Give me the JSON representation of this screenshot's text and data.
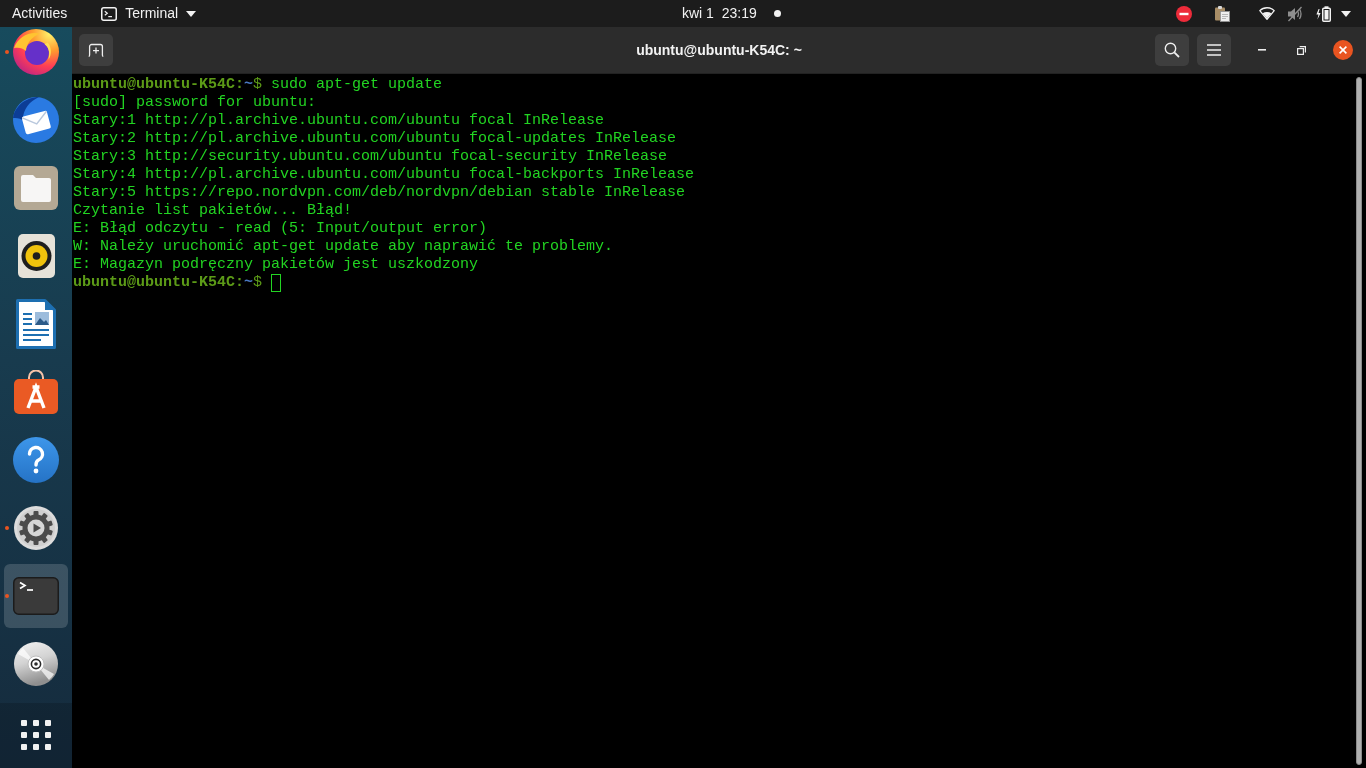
{
  "top_bar": {
    "activities": "Activities",
    "app_menu": "Terminal",
    "clock": "kwi 1  23:19"
  },
  "dock": {
    "items": [
      {
        "kind": "browser",
        "running": true,
        "selected": false
      },
      {
        "kind": "mail",
        "running": false,
        "selected": false
      },
      {
        "kind": "files",
        "running": false,
        "selected": false
      },
      {
        "kind": "music",
        "running": false,
        "selected": false
      },
      {
        "kind": "writer",
        "running": false,
        "selected": false
      },
      {
        "kind": "store",
        "running": false,
        "selected": false
      },
      {
        "kind": "help",
        "running": false,
        "selected": false
      },
      {
        "kind": "settings",
        "running": true,
        "selected": false
      },
      {
        "kind": "terminal",
        "running": true,
        "selected": true
      },
      {
        "kind": "disc",
        "running": false,
        "selected": false
      }
    ]
  },
  "window": {
    "title": "ubuntu@ubuntu-K54C: ~",
    "lines": [
      {
        "kind": "prompt",
        "user_host": "ubuntu@ubuntu-K54C:",
        "path": "~",
        "symbol": "$",
        "command": "sudo apt-get update",
        "cursor": false
      },
      {
        "kind": "output",
        "text": "[sudo] password for ubuntu:"
      },
      {
        "kind": "output",
        "text": "Stary:1 http://pl.archive.ubuntu.com/ubuntu focal InRelease"
      },
      {
        "kind": "output",
        "text": "Stary:2 http://pl.archive.ubuntu.com/ubuntu focal-updates InRelease"
      },
      {
        "kind": "output",
        "text": "Stary:3 http://security.ubuntu.com/ubuntu focal-security InRelease"
      },
      {
        "kind": "output",
        "text": "Stary:4 http://pl.archive.ubuntu.com/ubuntu focal-backports InRelease"
      },
      {
        "kind": "output",
        "text": "Stary:5 https://repo.nordvpn.com/deb/nordvpn/debian stable InRelease"
      },
      {
        "kind": "output",
        "text": "Czytanie list pakietów... Błąd!"
      },
      {
        "kind": "output",
        "text": "E: Błąd odczytu - read (5: Input/output error)"
      },
      {
        "kind": "output",
        "text": "W: Należy uruchomić apt-get update aby naprawić te problemy."
      },
      {
        "kind": "output",
        "text": "E: Magazyn podręczny pakietów jest uszkodzony"
      },
      {
        "kind": "prompt",
        "user_host": "ubuntu@ubuntu-K54C:",
        "path": "~",
        "symbol": "$",
        "cursor": true
      }
    ]
  }
}
